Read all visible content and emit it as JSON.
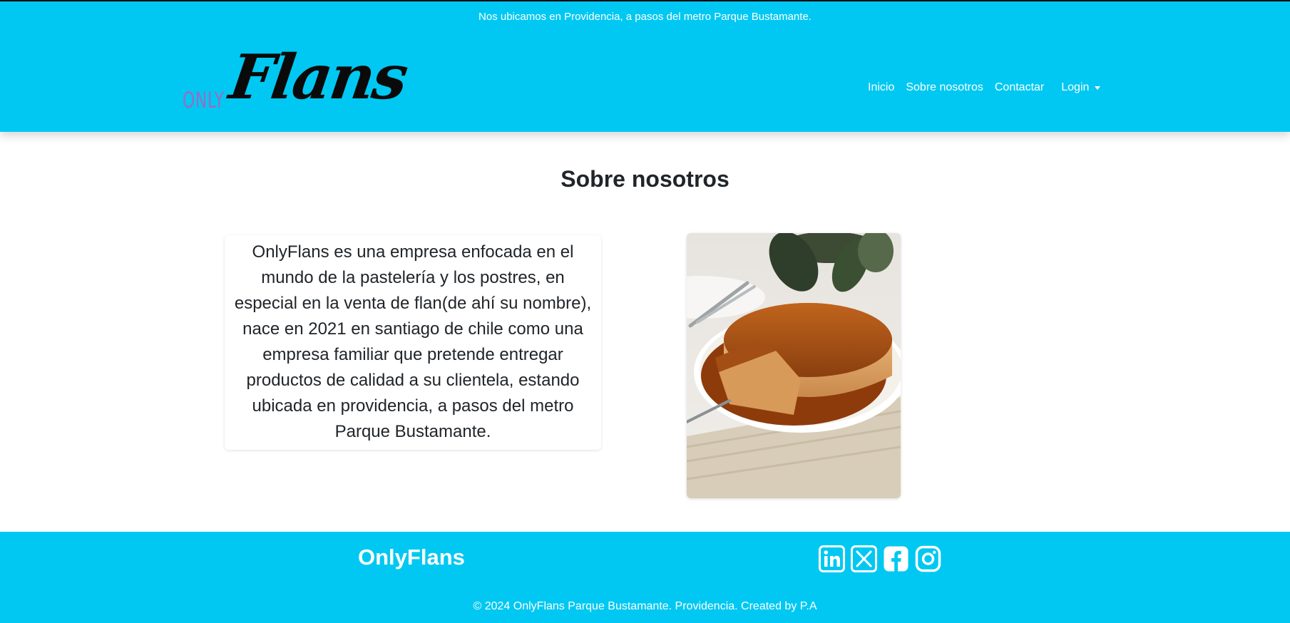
{
  "announcement": "Nos ubicamos en Providencia, a pasos del metro Parque Bustamante.",
  "logo": {
    "only": "ONLY",
    "flans": "Flans"
  },
  "nav": {
    "inicio": "Inicio",
    "sobre": "Sobre nosotros",
    "contactar": "Contactar",
    "login": "Login"
  },
  "page": {
    "title": "Sobre nosotros",
    "about_text": "OnlyFlans es una empresa enfocada en el mundo de la pastelería y los postres, en especial en la venta de flan(de ahí su nombre), nace en 2021 en santiago de chile como una empresa familiar que pretende entregar productos de calidad a su clientela, estando ubicada en providencia, a pasos del metro Parque Bustamante."
  },
  "footer": {
    "brand": "OnlyFlans",
    "copyright": "© 2024 OnlyFlans Parque Bustamante. Providencia. Created by P.A",
    "socials": [
      "linkedin-icon",
      "x-twitter-icon",
      "facebook-icon",
      "instagram-icon"
    ]
  },
  "colors": {
    "brand_cyan": "#00c8f2",
    "logo_purple": "#9b6bc4",
    "text_dark": "#212529"
  }
}
